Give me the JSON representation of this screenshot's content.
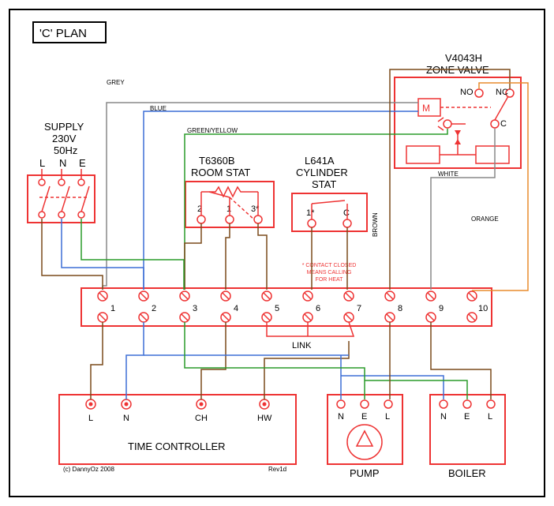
{
  "title": "'C' PLAN",
  "supply": {
    "label": "SUPPLY",
    "voltage": "230V",
    "freq": "50Hz",
    "terms": [
      "L",
      "N",
      "E"
    ]
  },
  "valve": {
    "model": "V4043H",
    "name": "ZONE VALVE",
    "terms": {
      "m": "M",
      "no": "NO",
      "nc": "NC",
      "c": "C"
    }
  },
  "roomstat": {
    "model": "T6360B",
    "name": "ROOM STAT",
    "terms": [
      "2",
      "1",
      "3*"
    ]
  },
  "cylstat": {
    "model": "L641A",
    "name": "CYLINDER",
    "name2": "STAT",
    "terms": [
      "1*",
      "C"
    ],
    "note1": "* CONTACT CLOSED",
    "note2": "MEANS CALLING",
    "note3": "FOR HEAT"
  },
  "strip": {
    "nums": [
      "1",
      "2",
      "3",
      "4",
      "5",
      "6",
      "7",
      "8",
      "9",
      "10"
    ],
    "link": "LINK"
  },
  "timectrl": {
    "name": "TIME CONTROLLER",
    "terms": [
      "L",
      "N",
      "CH",
      "HW"
    ]
  },
  "pump": {
    "name": "PUMP",
    "terms": [
      "N",
      "E",
      "L"
    ]
  },
  "boiler": {
    "name": "BOILER",
    "terms": [
      "N",
      "E",
      "L"
    ]
  },
  "wires": {
    "grey": "GREY",
    "blue": "BLUE",
    "gy": "GREEN/YELLOW",
    "brown": "BROWN",
    "white": "WHITE",
    "orange": "ORANGE"
  },
  "footer": {
    "copy": "(c) DannyOz 2008",
    "rev": "Rev1d"
  }
}
